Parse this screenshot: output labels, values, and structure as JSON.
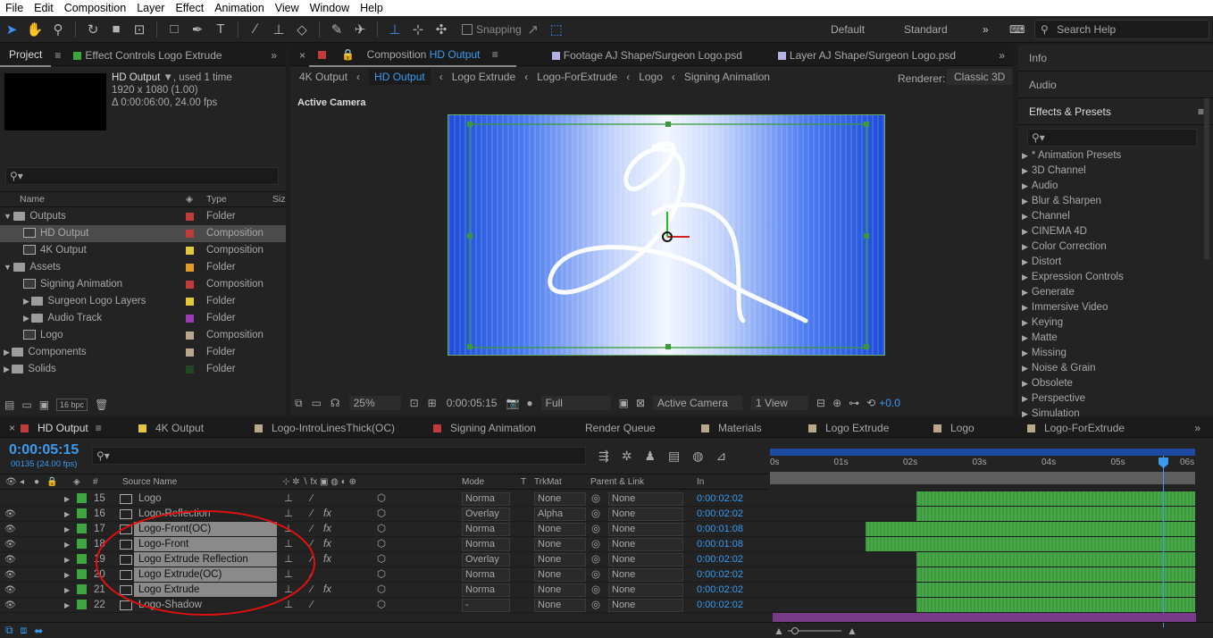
{
  "menu": [
    "File",
    "Edit",
    "Composition",
    "Layer",
    "Effect",
    "Animation",
    "View",
    "Window",
    "Help"
  ],
  "toolbar": {
    "snapping_label": "Snapping",
    "workspaces": [
      "Default",
      "Standard"
    ],
    "search_placeholder": "Search Help"
  },
  "project": {
    "tab": "Project",
    "effect_controls": "Effect Controls Logo Extrude",
    "comp_name": "HD Output",
    "used": ", used 1 time",
    "size": "1920 x 1080 (1.00)",
    "duration": "Δ 0:00:06:00, 24.00 fps",
    "col_name": "Name",
    "col_type": "Type",
    "col_size": "Siz",
    "items": [
      {
        "name": "Outputs",
        "type": "Folder",
        "color": "#c23b3b",
        "level": 0,
        "kind": "folder",
        "open": true
      },
      {
        "name": "HD Output",
        "type": "Composition",
        "color": "#c23b3b",
        "level": 1,
        "kind": "comp",
        "selected": true
      },
      {
        "name": "4K Output",
        "type": "Composition",
        "color": "#e3c83b",
        "level": 1,
        "kind": "comp"
      },
      {
        "name": "Assets",
        "type": "Folder",
        "color": "#e39a2a",
        "level": 0,
        "kind": "folder",
        "open": true
      },
      {
        "name": "Signing Animation",
        "type": "Composition",
        "color": "#c23b3b",
        "level": 1,
        "kind": "comp"
      },
      {
        "name": "Surgeon Logo Layers",
        "type": "Folder",
        "color": "#e3c83b",
        "level": 1,
        "kind": "folder"
      },
      {
        "name": "Audio Track",
        "type": "Folder",
        "color": "#9a3bb3",
        "level": 1,
        "kind": "folder"
      },
      {
        "name": "Logo",
        "type": "Composition",
        "color": "#bba88a",
        "level": 1,
        "kind": "comp"
      },
      {
        "name": "Components",
        "type": "Folder",
        "color": "#bba88a",
        "level": 0,
        "kind": "folder"
      },
      {
        "name": "Solids",
        "type": "Folder",
        "color": "#1f4a1f",
        "level": 0,
        "kind": "folder"
      }
    ],
    "bpc": "16 bpc"
  },
  "comp": {
    "tab_label": "Composition",
    "tab_comp": "HD Output",
    "footage_tab": "Footage  AJ Shape/Surgeon Logo.psd",
    "layer_tab": "Layer  AJ Shape/Surgeon Logo.psd",
    "breadcrumbs": [
      "4K Output",
      "HD Output",
      "Logo Extrude",
      "Logo-ForExtrude",
      "Logo",
      "Signing Animation"
    ],
    "renderer_label": "Renderer:",
    "renderer": "Classic 3D",
    "camera_label": "Active Camera",
    "zoom": "25%",
    "timecode": "0:00:05:15",
    "resolution": "Full",
    "view_camera": "Active Camera",
    "views": "1 View",
    "exposure": "+0.0"
  },
  "right": {
    "info": "Info",
    "audio": "Audio",
    "effects": "Effects & Presets",
    "categories": [
      "* Animation Presets",
      "3D Channel",
      "Audio",
      "Blur & Sharpen",
      "Channel",
      "CINEMA 4D",
      "Color Correction",
      "Distort",
      "Expression Controls",
      "Generate",
      "Immersive Video",
      "Keying",
      "Matte",
      "Missing",
      "Noise & Grain",
      "Obsolete",
      "Perspective",
      "Simulation"
    ]
  },
  "timeline": {
    "tabs": [
      {
        "label": "HD Output",
        "color": "#c23b3b",
        "active": true
      },
      {
        "label": "4K Output",
        "color": "#e3c83b"
      },
      {
        "label": "Logo-IntroLinesThick(OC)",
        "color": "#bba88a"
      },
      {
        "label": "Signing Animation",
        "color": "#c23b3b"
      },
      {
        "label": "Render Queue",
        "color": ""
      },
      {
        "label": "Materials",
        "color": "#bba88a"
      },
      {
        "label": "Logo Extrude",
        "color": "#bba88a"
      },
      {
        "label": "Logo",
        "color": "#bba88a"
      },
      {
        "label": "Logo-ForExtrude",
        "color": "#bba88a"
      }
    ],
    "timecode": "0:00:05:15",
    "frames": "00135 (24.00 fps)",
    "col_source": "Source Name",
    "col_mode": "Mode",
    "col_t": "T",
    "col_trkmat": "TrkMat",
    "col_parent": "Parent & Link",
    "col_in": "In",
    "ruler": [
      "0s",
      "01s",
      "02s",
      "03s",
      "04s",
      "05s",
      "06s"
    ],
    "layers": [
      {
        "idx": "15",
        "name": "Logo",
        "mode": "Norma",
        "trk": "None",
        "parent": "None",
        "in": "0:00:02:02",
        "start": 0.34,
        "hl": false,
        "fx": false
      },
      {
        "idx": "16",
        "name": "Logo-Reflection",
        "mode": "Overlay",
        "trk": "Alpha",
        "parent": "None",
        "in": "0:00:02:02",
        "start": 0.34,
        "hl": false,
        "fx": true
      },
      {
        "idx": "17",
        "name": "Logo-Front(OC)",
        "mode": "Norma",
        "trk": "None",
        "parent": "None",
        "in": "0:00:01:08",
        "start": 0.22,
        "hl": true,
        "fx": true
      },
      {
        "idx": "18",
        "name": "Logo-Front",
        "mode": "Norma",
        "trk": "None",
        "parent": "None",
        "in": "0:00:01:08",
        "start": 0.22,
        "hl": true,
        "fx": true
      },
      {
        "idx": "19",
        "name": "Logo Extrude Reflection",
        "mode": "Overlay",
        "trk": "None",
        "parent": "None",
        "in": "0:00:02:02",
        "start": 0.34,
        "hl": true,
        "fx": true
      },
      {
        "idx": "20",
        "name": "Logo Extrude(OC)",
        "mode": "Norma",
        "trk": "None",
        "parent": "None",
        "in": "0:00:02:02",
        "start": 0.34,
        "hl": true,
        "fx": false
      },
      {
        "idx": "21",
        "name": "Logo Extrude",
        "mode": "Norma",
        "trk": "None",
        "parent": "None",
        "in": "0:00:02:02",
        "start": 0.34,
        "hl": true,
        "fx": true
      },
      {
        "idx": "22",
        "name": "Logo-Shadow",
        "mode": "-",
        "trk": "None",
        "parent": "None",
        "in": "0:00:02:02",
        "start": 0.34,
        "hl": false,
        "fx": false
      }
    ]
  }
}
